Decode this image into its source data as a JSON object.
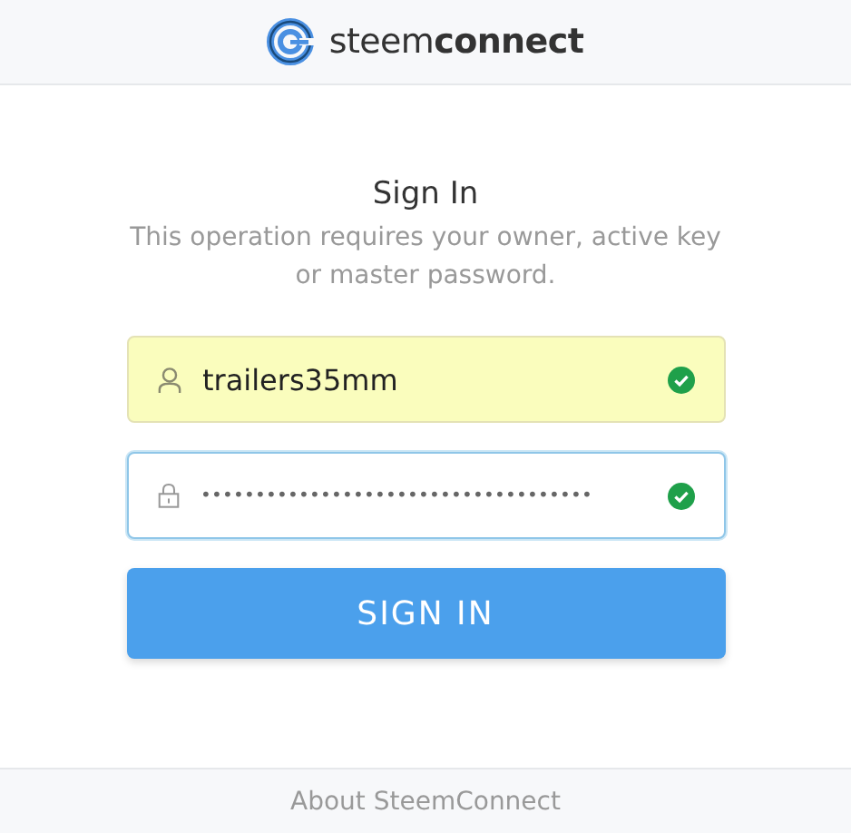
{
  "header": {
    "logo_text": "steem**connect**"
  },
  "title": "Sign In",
  "subtitle": "This operation requires your owner, active key or master password.",
  "fields": [
    {
      "kind": "username",
      "value": "trailers35mm",
      "valid": true,
      "autofilled": true,
      "focused": false
    },
    {
      "kind": "password",
      "value": "••••••••••••••••••••••••••••••••••••",
      "valid": true,
      "autofilled": false,
      "focused": true
    }
  ],
  "submit": {
    "label": "SIGN IN"
  },
  "footer": {
    "link": "About SteemConnect"
  }
}
